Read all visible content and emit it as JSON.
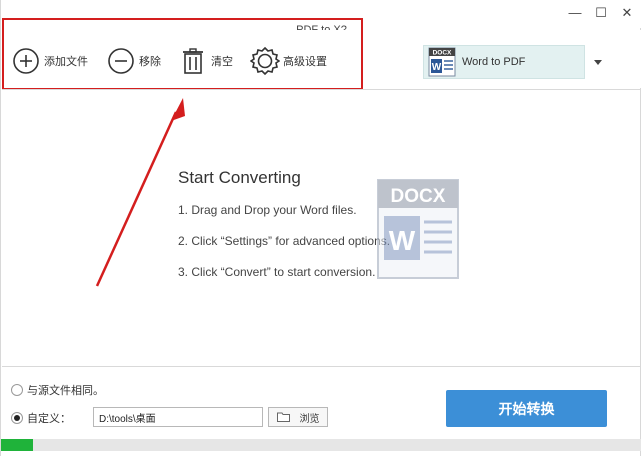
{
  "window": {
    "title": "PDF to X?",
    "minimize_glyph": "—",
    "maximize_glyph": "☐",
    "close_glyph": "✕"
  },
  "toolbar": {
    "add_label": "添加文件",
    "remove_label": "移除",
    "clear_label": "清空",
    "settings_label": "高级设置"
  },
  "format": {
    "icon_text": "DOCX",
    "selected": "Word to PDF"
  },
  "content": {
    "heading": "Start Converting",
    "steps": [
      "1. Drag and Drop your Word files.",
      "2. Click “Settings” for advanced options.",
      "3. Click “Convert” to start conversion."
    ],
    "watermark_text": "DOCX"
  },
  "output": {
    "same_as_source_label": "与源文件相同。",
    "custom_label": "自定义：",
    "custom_path": "D:\\tools\\桌面",
    "browse_label": "浏览",
    "selected_option": "custom"
  },
  "convert_label": "开始转换",
  "progress": {
    "fraction": 0.05,
    "color": "#1fb33a"
  },
  "colors": {
    "annotation": "#d41e1e",
    "accent": "#3c8fd7",
    "format_bg": "#e3f1f1"
  },
  "icons": [
    "plus-circle-icon",
    "minus-circle-icon",
    "trash-icon",
    "gear-icon",
    "docx-icon",
    "folder-icon",
    "chevron-down-icon"
  ]
}
